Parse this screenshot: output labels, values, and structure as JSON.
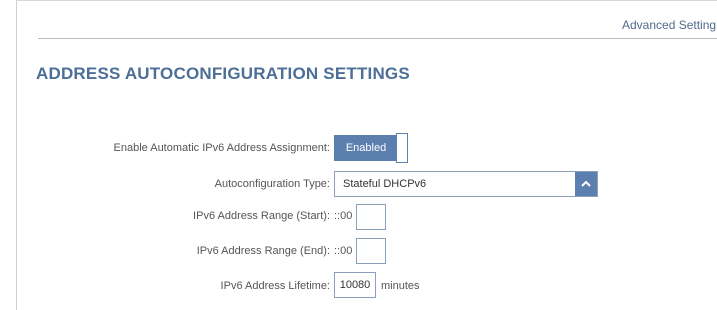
{
  "header": {
    "breadcrumb": "Advanced Setting"
  },
  "section": {
    "title": "ADDRESS AUTOCONFIGURATION SETTINGS"
  },
  "form": {
    "auto_assign": {
      "label": "Enable Automatic IPv6 Address Assignment:",
      "value": "Enabled"
    },
    "autoconfig_type": {
      "label": "Autoconfiguration Type:",
      "value": "Stateful DHCPv6",
      "icon": "chevron-up-icon"
    },
    "range_start": {
      "label": "IPv6 Address Range (Start):",
      "prefix": "::00",
      "value": ""
    },
    "range_end": {
      "label": "IPv6 Address Range (End):",
      "prefix": "::00",
      "value": ""
    },
    "lifetime": {
      "label": "IPv6 Address Lifetime:",
      "value": "10080",
      "unit": "minutes"
    }
  },
  "colors": {
    "accent": "#5b7fae",
    "title": "#4d6f97",
    "border": "#8aa0bb"
  }
}
